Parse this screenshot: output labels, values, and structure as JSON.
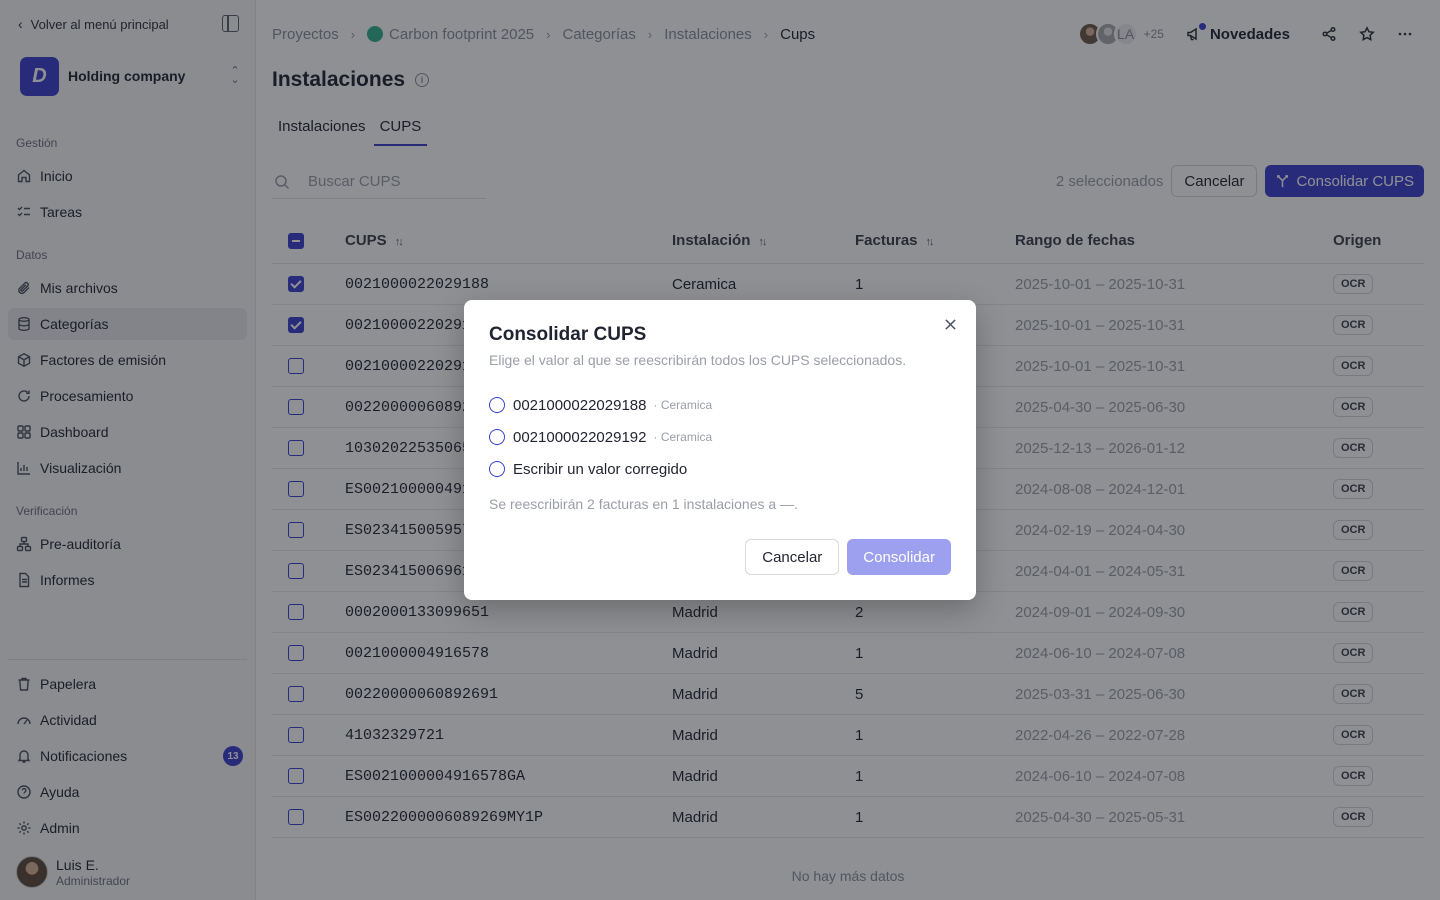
{
  "sidebar": {
    "back_label": "Volver al menú principal",
    "org_name": "Holding company",
    "sections": {
      "gestion": "Gestión",
      "datos": "Datos",
      "verificacion": "Verificación"
    },
    "items": {
      "inicio": "Inicio",
      "tareas": "Tareas",
      "archivos": "Mis archivos",
      "categorias": "Categorías",
      "factores": "Factores de emisión",
      "procesamiento": "Procesamiento",
      "dashboard": "Dashboard",
      "visualizacion": "Visualización",
      "preauditoria": "Pre-auditoría",
      "informes": "Informes",
      "papelera": "Papelera",
      "actividad": "Actividad",
      "notificaciones": "Notificaciones",
      "ayuda": "Ayuda",
      "admin": "Admin"
    },
    "notifications_count": "13",
    "user": {
      "name": "Luis E.",
      "role": "Administrador"
    }
  },
  "header": {
    "breadcrumb": [
      "Proyectos",
      "Carbon footprint 2025",
      "Categorías",
      "Instalaciones",
      "Cups"
    ],
    "avatar_initials": "LA",
    "avatar_more": "+25",
    "news_label": "Novedades"
  },
  "page": {
    "title": "Instalaciones",
    "tabs": [
      "Instalaciones",
      "CUPS"
    ],
    "search_placeholder": "Buscar CUPS",
    "selected_count": "2 seleccionados",
    "cancel_label": "Cancelar",
    "consolidate_label": "Consolidar CUPS",
    "no_more": "No hay más datos"
  },
  "table": {
    "headers": {
      "cups": "CUPS",
      "instalacion": "Instalación",
      "facturas": "Facturas",
      "rango": "Rango de fechas",
      "origen": "Origen"
    },
    "rows": [
      {
        "checked": true,
        "cups": "0021000022029188",
        "instalacion": "Ceramica",
        "facturas": "1",
        "rango": "2025-10-01 – 2025-10-31",
        "origen": "OCR"
      },
      {
        "checked": true,
        "cups": "00210000220291",
        "instalacion": "",
        "facturas": "",
        "rango": "2025-10-01 – 2025-10-31",
        "origen": "OCR"
      },
      {
        "checked": false,
        "cups": "00210000220291",
        "instalacion": "",
        "facturas": "",
        "rango": "2025-10-01 – 2025-10-31",
        "origen": "OCR"
      },
      {
        "checked": false,
        "cups": "00220000060892",
        "instalacion": "",
        "facturas": "",
        "rango": "2025-04-30 – 2025-06-30",
        "origen": "OCR"
      },
      {
        "checked": false,
        "cups": "10302022535065",
        "instalacion": "",
        "facturas": "",
        "rango": "2025-12-13 – 2026-01-12",
        "origen": "OCR"
      },
      {
        "checked": false,
        "cups": "ES002100000491",
        "instalacion": "",
        "facturas": "",
        "rango": "2024-08-08 – 2024-12-01",
        "origen": "OCR"
      },
      {
        "checked": false,
        "cups": "ES023415005957",
        "instalacion": "",
        "facturas": "",
        "rango": "2024-02-19 – 2024-04-30",
        "origen": "OCR"
      },
      {
        "checked": false,
        "cups": "ES023415006961",
        "instalacion": "",
        "facturas": "",
        "rango": "2024-04-01 – 2024-05-31",
        "origen": "OCR"
      },
      {
        "checked": false,
        "cups": "0002000133099651",
        "instalacion": "Madrid",
        "facturas": "2",
        "rango": "2024-09-01 – 2024-09-30",
        "origen": "OCR"
      },
      {
        "checked": false,
        "cups": "0021000004916578",
        "instalacion": "Madrid",
        "facturas": "1",
        "rango": "2024-06-10 – 2024-07-08",
        "origen": "OCR"
      },
      {
        "checked": false,
        "cups": "00220000060892691",
        "instalacion": "Madrid",
        "facturas": "5",
        "rango": "2025-03-31 – 2025-06-30",
        "origen": "OCR"
      },
      {
        "checked": false,
        "cups": "41032329721",
        "instalacion": "Madrid",
        "facturas": "1",
        "rango": "2022-04-26 – 2022-07-28",
        "origen": "OCR"
      },
      {
        "checked": false,
        "cups": "ES0021000004916578GA",
        "instalacion": "Madrid",
        "facturas": "1",
        "rango": "2024-06-10 – 2024-07-08",
        "origen": "OCR"
      },
      {
        "checked": false,
        "cups": "ES0022000006089269MY1P",
        "instalacion": "Madrid",
        "facturas": "1",
        "rango": "2025-04-30 – 2025-05-31",
        "origen": "OCR"
      }
    ]
  },
  "modal": {
    "title": "Consolidar CUPS",
    "subtitle": "Elige el valor al que se reescribirán todos los CUPS seleccionados.",
    "options": [
      {
        "value": "0021000022029188",
        "meta": "· Ceramica"
      },
      {
        "value": "0021000022029192",
        "meta": "· Ceramica"
      },
      {
        "value": "Escribir un valor corregido",
        "meta": ""
      }
    ],
    "note": "Se reescribirán 2 facturas en 1 instalaciones a —.",
    "cancel_label": "Cancelar",
    "confirm_label": "Consolidar"
  },
  "colors": {
    "accent": "#3a3fd0",
    "accent_disabled": "#9da0ee",
    "project_dot": "#2fb18d"
  }
}
